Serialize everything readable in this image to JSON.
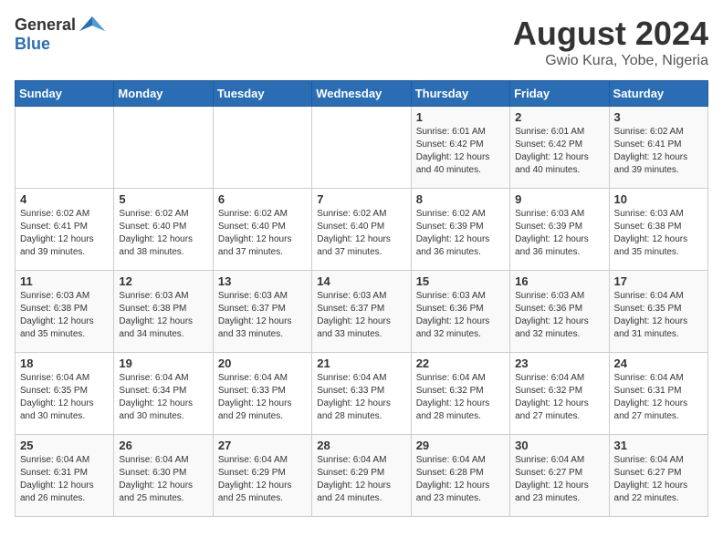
{
  "header": {
    "logo_general": "General",
    "logo_blue": "Blue",
    "month_title": "August 2024",
    "location": "Gwio Kura, Yobe, Nigeria"
  },
  "days_of_week": [
    "Sunday",
    "Monday",
    "Tuesday",
    "Wednesday",
    "Thursday",
    "Friday",
    "Saturday"
  ],
  "weeks": [
    [
      {
        "day": "",
        "info": ""
      },
      {
        "day": "",
        "info": ""
      },
      {
        "day": "",
        "info": ""
      },
      {
        "day": "",
        "info": ""
      },
      {
        "day": "1",
        "info": "Sunrise: 6:01 AM\nSunset: 6:42 PM\nDaylight: 12 hours\nand 40 minutes."
      },
      {
        "day": "2",
        "info": "Sunrise: 6:01 AM\nSunset: 6:42 PM\nDaylight: 12 hours\nand 40 minutes."
      },
      {
        "day": "3",
        "info": "Sunrise: 6:02 AM\nSunset: 6:41 PM\nDaylight: 12 hours\nand 39 minutes."
      }
    ],
    [
      {
        "day": "4",
        "info": "Sunrise: 6:02 AM\nSunset: 6:41 PM\nDaylight: 12 hours\nand 39 minutes."
      },
      {
        "day": "5",
        "info": "Sunrise: 6:02 AM\nSunset: 6:40 PM\nDaylight: 12 hours\nand 38 minutes."
      },
      {
        "day": "6",
        "info": "Sunrise: 6:02 AM\nSunset: 6:40 PM\nDaylight: 12 hours\nand 37 minutes."
      },
      {
        "day": "7",
        "info": "Sunrise: 6:02 AM\nSunset: 6:40 PM\nDaylight: 12 hours\nand 37 minutes."
      },
      {
        "day": "8",
        "info": "Sunrise: 6:02 AM\nSunset: 6:39 PM\nDaylight: 12 hours\nand 36 minutes."
      },
      {
        "day": "9",
        "info": "Sunrise: 6:03 AM\nSunset: 6:39 PM\nDaylight: 12 hours\nand 36 minutes."
      },
      {
        "day": "10",
        "info": "Sunrise: 6:03 AM\nSunset: 6:38 PM\nDaylight: 12 hours\nand 35 minutes."
      }
    ],
    [
      {
        "day": "11",
        "info": "Sunrise: 6:03 AM\nSunset: 6:38 PM\nDaylight: 12 hours\nand 35 minutes."
      },
      {
        "day": "12",
        "info": "Sunrise: 6:03 AM\nSunset: 6:38 PM\nDaylight: 12 hours\nand 34 minutes."
      },
      {
        "day": "13",
        "info": "Sunrise: 6:03 AM\nSunset: 6:37 PM\nDaylight: 12 hours\nand 33 minutes."
      },
      {
        "day": "14",
        "info": "Sunrise: 6:03 AM\nSunset: 6:37 PM\nDaylight: 12 hours\nand 33 minutes."
      },
      {
        "day": "15",
        "info": "Sunrise: 6:03 AM\nSunset: 6:36 PM\nDaylight: 12 hours\nand 32 minutes."
      },
      {
        "day": "16",
        "info": "Sunrise: 6:03 AM\nSunset: 6:36 PM\nDaylight: 12 hours\nand 32 minutes."
      },
      {
        "day": "17",
        "info": "Sunrise: 6:04 AM\nSunset: 6:35 PM\nDaylight: 12 hours\nand 31 minutes."
      }
    ],
    [
      {
        "day": "18",
        "info": "Sunrise: 6:04 AM\nSunset: 6:35 PM\nDaylight: 12 hours\nand 30 minutes."
      },
      {
        "day": "19",
        "info": "Sunrise: 6:04 AM\nSunset: 6:34 PM\nDaylight: 12 hours\nand 30 minutes."
      },
      {
        "day": "20",
        "info": "Sunrise: 6:04 AM\nSunset: 6:33 PM\nDaylight: 12 hours\nand 29 minutes."
      },
      {
        "day": "21",
        "info": "Sunrise: 6:04 AM\nSunset: 6:33 PM\nDaylight: 12 hours\nand 28 minutes."
      },
      {
        "day": "22",
        "info": "Sunrise: 6:04 AM\nSunset: 6:32 PM\nDaylight: 12 hours\nand 28 minutes."
      },
      {
        "day": "23",
        "info": "Sunrise: 6:04 AM\nSunset: 6:32 PM\nDaylight: 12 hours\nand 27 minutes."
      },
      {
        "day": "24",
        "info": "Sunrise: 6:04 AM\nSunset: 6:31 PM\nDaylight: 12 hours\nand 27 minutes."
      }
    ],
    [
      {
        "day": "25",
        "info": "Sunrise: 6:04 AM\nSunset: 6:31 PM\nDaylight: 12 hours\nand 26 minutes."
      },
      {
        "day": "26",
        "info": "Sunrise: 6:04 AM\nSunset: 6:30 PM\nDaylight: 12 hours\nand 25 minutes."
      },
      {
        "day": "27",
        "info": "Sunrise: 6:04 AM\nSunset: 6:29 PM\nDaylight: 12 hours\nand 25 minutes."
      },
      {
        "day": "28",
        "info": "Sunrise: 6:04 AM\nSunset: 6:29 PM\nDaylight: 12 hours\nand 24 minutes."
      },
      {
        "day": "29",
        "info": "Sunrise: 6:04 AM\nSunset: 6:28 PM\nDaylight: 12 hours\nand 23 minutes."
      },
      {
        "day": "30",
        "info": "Sunrise: 6:04 AM\nSunset: 6:27 PM\nDaylight: 12 hours\nand 23 minutes."
      },
      {
        "day": "31",
        "info": "Sunrise: 6:04 AM\nSunset: 6:27 PM\nDaylight: 12 hours\nand 22 minutes."
      }
    ]
  ]
}
